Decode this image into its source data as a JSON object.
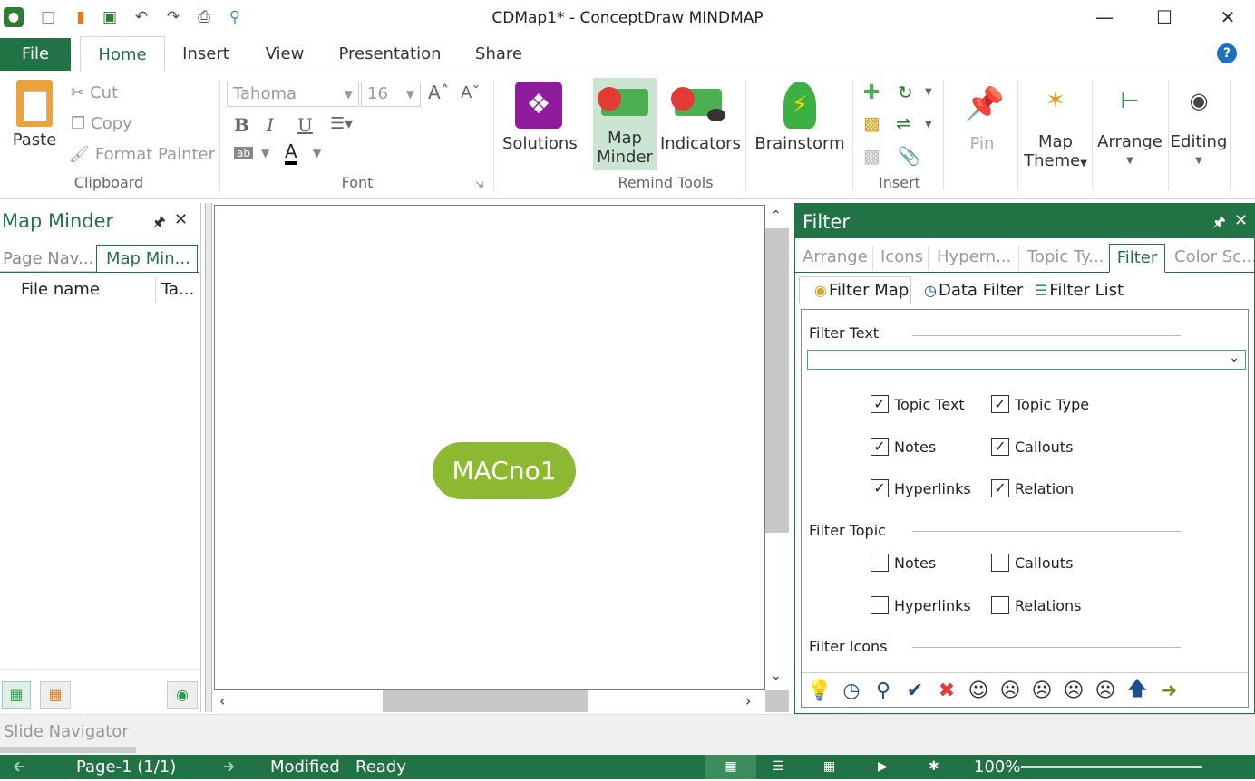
{
  "window": {
    "title": "CDMap1* - ConceptDraw MINDMAP"
  },
  "ribbon_tabs": [
    "File",
    "Home",
    "Insert",
    "View",
    "Presentation",
    "Share"
  ],
  "clipboard": {
    "paste": "Paste",
    "cut": "Cut",
    "copy": "Copy",
    "format_painter": "Format Painter",
    "group": "Clipboard"
  },
  "font": {
    "family": "Tahoma",
    "size": "16",
    "group": "Font",
    "bold": "B",
    "italic": "I",
    "underline": "U",
    "color_letter": "A"
  },
  "remind": {
    "solutions": "Solutions",
    "map_minder_1": "Map",
    "map_minder_2": "Minder",
    "indicators": "Indicators",
    "group": "Remind Tools"
  },
  "brainstorm": "Brainstorm",
  "insert_group": "Insert",
  "pin": "Pin",
  "map_theme_1": "Map",
  "map_theme_2": "Theme",
  "arrange": "Arrange",
  "editing": "Editing",
  "left_pane": {
    "title": "Map Minder",
    "tabs": [
      "Page Nav...",
      "Map Min..."
    ],
    "columns": [
      "File name",
      "Ta..."
    ]
  },
  "canvas": {
    "topic": "MACno1",
    "topic_color": "#8db832"
  },
  "filter_pane": {
    "title": "Filter",
    "tabs": [
      "Arrange",
      "Icons",
      "Hypern...",
      "Topic Ty...",
      "Filter",
      "Color Sc..."
    ],
    "subtabs": [
      "Filter Map",
      "Data Filter",
      "Filter List"
    ],
    "filter_text_label": "Filter Text",
    "filter_text_value": "",
    "text_options": [
      {
        "label": "Topic Text",
        "checked": true
      },
      {
        "label": "Topic Type",
        "checked": true
      },
      {
        "label": "Notes",
        "checked": true
      },
      {
        "label": "Callouts",
        "checked": true
      },
      {
        "label": "Hyperlinks",
        "checked": true
      },
      {
        "label": "Relation",
        "checked": true
      }
    ],
    "filter_topic_label": "Filter Topic",
    "topic_options": [
      {
        "label": "Notes",
        "checked": false
      },
      {
        "label": "Callouts",
        "checked": false
      },
      {
        "label": "Hyperlinks",
        "checked": false
      },
      {
        "label": "Relations",
        "checked": false
      }
    ],
    "filter_icons_label": "Filter Icons",
    "icons": [
      "lightbulb-icon",
      "clock-icon",
      "search-person-icon",
      "checkmark-icon",
      "cross-icon",
      "smile-icon",
      "neutral-face-icon",
      "sad-face-icon",
      "frown-face-icon",
      "angry-face-icon",
      "arrow-up-icon",
      "arrow-right-icon"
    ]
  },
  "slide_navigator": "Slide Navigator",
  "status": {
    "page": "Page-1 (1/1)",
    "modified": "Modified",
    "ready": "Ready",
    "zoom": "100%"
  },
  "colors": {
    "accent": "#217346",
    "topic": "#8db832"
  }
}
